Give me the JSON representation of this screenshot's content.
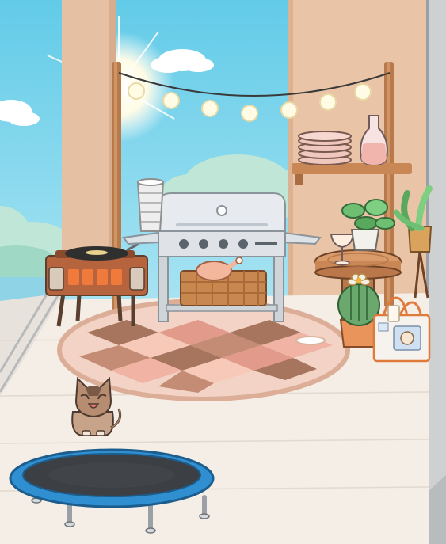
{
  "scene": {
    "type": "toca-style patio room",
    "items": [
      {
        "name": "record-player",
        "icon": "record-player-icon"
      },
      {
        "name": "stacked-cups",
        "icon": "cups-icon"
      },
      {
        "name": "barbecue-grill",
        "icon": "grill-icon"
      },
      {
        "name": "roast-chicken",
        "icon": "chicken-icon"
      },
      {
        "name": "wicker-basket",
        "icon": "basket-icon"
      },
      {
        "name": "string-lights",
        "icon": "bulb-icon"
      },
      {
        "name": "plate-stack",
        "icon": "plates-icon"
      },
      {
        "name": "glass-carafe",
        "icon": "carafe-icon"
      },
      {
        "name": "potted-plants",
        "icon": "plant-icon"
      },
      {
        "name": "wine-glass",
        "icon": "glass-icon"
      },
      {
        "name": "round-side-table",
        "icon": "table-icon"
      },
      {
        "name": "flowering-cactus",
        "icon": "cactus-icon"
      },
      {
        "name": "tote-bag",
        "icon": "bag-icon"
      },
      {
        "name": "checkered-rug",
        "icon": "rug-icon"
      },
      {
        "name": "tabby-cat",
        "icon": "cat-icon"
      },
      {
        "name": "trampoline",
        "icon": "trampoline-icon"
      }
    ],
    "colors": {
      "sky": "#7fd3ea",
      "wall": "#e9c4a6",
      "floor": "#f4eee6",
      "wood": "#b87a4a",
      "grill": "#d8dde3",
      "trampoline": "#2f8fd0",
      "rug_pink": "#f1c6b8",
      "rug_brown": "#a7755e"
    }
  }
}
